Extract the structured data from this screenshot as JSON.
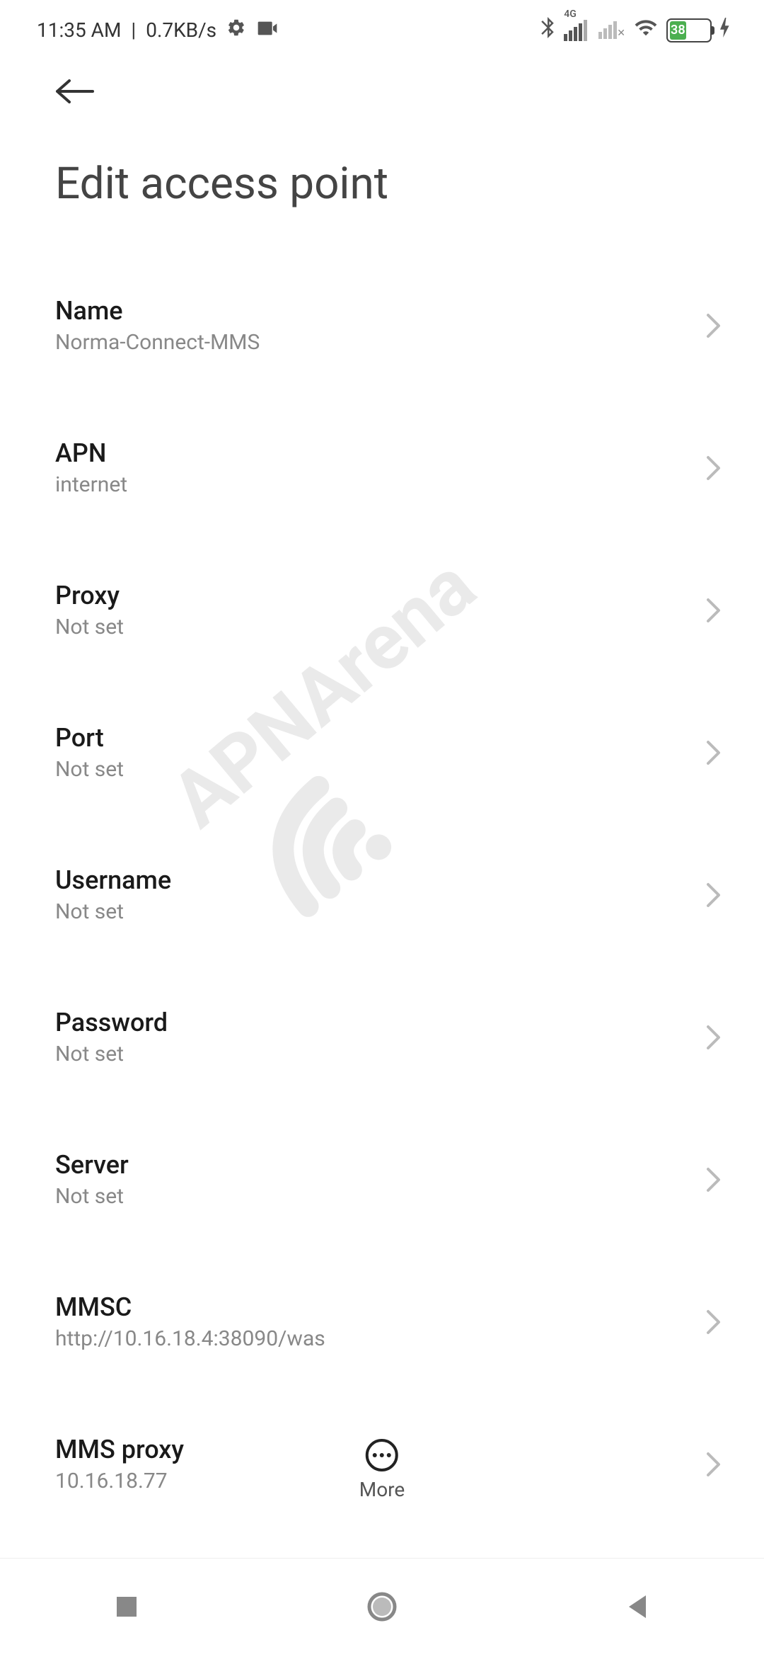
{
  "statusBar": {
    "time": "11:35 AM",
    "netSpeed": "0.7KB/s",
    "networkIndicator": "4G",
    "batteryPercent": "38"
  },
  "page": {
    "title": "Edit access point"
  },
  "settings": {
    "name": {
      "label": "Name",
      "value": "Norma-Connect-MMS"
    },
    "apn": {
      "label": "APN",
      "value": "internet"
    },
    "proxy": {
      "label": "Proxy",
      "value": "Not set"
    },
    "port": {
      "label": "Port",
      "value": "Not set"
    },
    "username": {
      "label": "Username",
      "value": "Not set"
    },
    "password": {
      "label": "Password",
      "value": "Not set"
    },
    "server": {
      "label": "Server",
      "value": "Not set"
    },
    "mmsc": {
      "label": "MMSC",
      "value": "http://10.16.18.4:38090/was"
    },
    "mmsProxy": {
      "label": "MMS proxy",
      "value": "10.16.18.77"
    }
  },
  "more": {
    "label": "More"
  },
  "watermark": {
    "text": "APNArena"
  }
}
